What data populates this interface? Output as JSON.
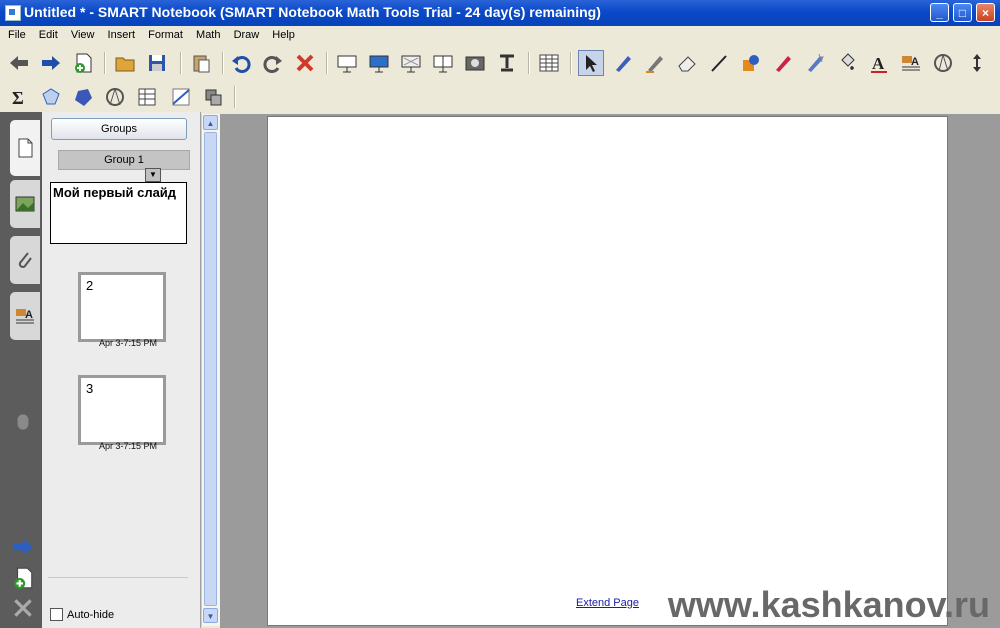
{
  "window": {
    "title": "Untitled * - SMART Notebook (SMART Notebook Math Tools Trial - 24 day(s) remaining)",
    "minimize_glyph": "_",
    "maximize_glyph": "□",
    "close_glyph": "×"
  },
  "menu": [
    "File",
    "Edit",
    "View",
    "Insert",
    "Format",
    "Math",
    "Draw",
    "Help"
  ],
  "toolbar_row1_icons": [
    "back-icon",
    "forward-icon",
    "add-page-icon",
    "open-folder-icon",
    "save-icon",
    "paste-icon",
    "undo-icon",
    "redo-icon",
    "delete-icon",
    "screen-shade-icon",
    "full-screen-icon",
    "transparent-bg-icon",
    "dual-page-icon",
    "capture-icon",
    "document-camera-icon",
    "table-icon",
    "select-icon",
    "pen-icon",
    "creative-pen-icon",
    "eraser-icon",
    "line-icon",
    "shapes-icon",
    "magic-pen-icon",
    "shape-recognition-icon",
    "fill-icon",
    "text-icon",
    "properties-icon",
    "measure-icon",
    "toolbar-move-icon"
  ],
  "toolbar_row2_icons": [
    "sigma-icon",
    "3d-shape-icon",
    "polygon-icon",
    "compass-icon",
    "math-table-icon",
    "graph-icon",
    "math-tools-icon"
  ],
  "sorter": {
    "groups_button": "Groups",
    "group_label": "Group 1",
    "slide1_text": "Мой первый слайд",
    "slides": [
      {
        "number": "2",
        "timestamp": "Apr 3-7:15 PM"
      },
      {
        "number": "3",
        "timestamp": "Apr 3-7:15 PM"
      }
    ],
    "autohide_label": "Auto-hide"
  },
  "page": {
    "extend_link": "Extend Page"
  },
  "watermark": "www.kashkanov.ru"
}
